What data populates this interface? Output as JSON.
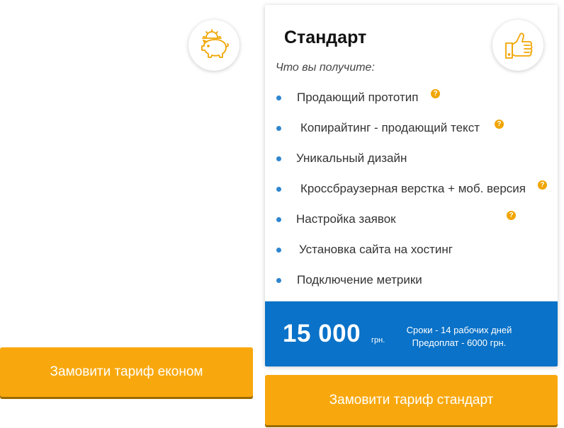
{
  "icons": {
    "econom_icon": "piggy-bank-icon",
    "standard_icon": "thumbs-up-icon",
    "accent_color": "#f0a500"
  },
  "standard_plan": {
    "title": "Стандарт",
    "subtitle": "Что вы получите:",
    "features": [
      {
        "label": "Продающий прототип",
        "has_help": true
      },
      {
        "label": "Копирайтинг - продающий текст",
        "has_help": true
      },
      {
        "label": "Уникальный дизайн",
        "has_help": false
      },
      {
        "label": "Кроссбраузерная верстка + моб. версия",
        "has_help": true
      },
      {
        "label": "Настройка заявок",
        "has_help": true
      },
      {
        "label": "Установка сайта на хостинг",
        "has_help": false
      },
      {
        "label": "Подключение метрики",
        "has_help": false
      }
    ],
    "help_mark": "?",
    "price": "15 000",
    "currency": "грн.",
    "terms_line1": "Сроки - 14 рабочих дней",
    "terms_line2": "Предоплат - 6000 грн.",
    "price_bar_color": "#0a72c8"
  },
  "buttons": {
    "econom_label": "Замовити тариф економ",
    "standard_label": "Замовити тариф стандарт",
    "color": "#f8a80d"
  }
}
